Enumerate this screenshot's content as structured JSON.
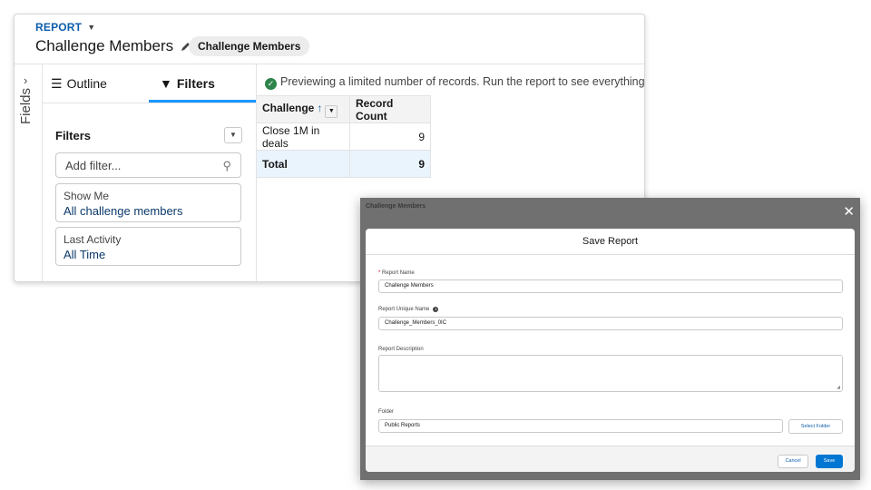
{
  "report": {
    "eyebrow": "REPORT",
    "title": "Challenge Members",
    "pill": "Challenge Members"
  },
  "rail": {
    "label": "Fields"
  },
  "tabs": [
    {
      "label": "Outline",
      "icon": "list-icon"
    },
    {
      "label": "Filters",
      "icon": "funnel-icon"
    }
  ],
  "filters": {
    "title": "Filters",
    "add_placeholder": "Add filter...",
    "items": [
      {
        "label": "Show Me",
        "value": "All challenge members"
      },
      {
        "label": "Last Activity",
        "value": "All Time"
      }
    ]
  },
  "preview": {
    "notice": "Previewing a limited number of records. Run the report to see everything.",
    "columns": [
      "Challenge",
      "Record Count"
    ],
    "rows": [
      {
        "challenge": "Close 1M in deals",
        "count": "9"
      }
    ],
    "total": {
      "label": "Total",
      "count": "9"
    }
  },
  "modal": {
    "bg_title": "Challenge Members",
    "title": "Save Report",
    "report_name_label": "Report Name",
    "report_name_value": "Challenge Members",
    "unique_name_label": "Report Unique Name",
    "unique_name_value": "Challenge_Members_0IC",
    "description_label": "Report Description",
    "folder_label": "Folder",
    "folder_value": "Public Reports",
    "select_folder": "Select Folder",
    "cancel": "Cancel",
    "save": "Save"
  },
  "colors": {
    "brand_blue": "#0176d3",
    "link_blue": "#0b5cab",
    "success_green": "#2e844a",
    "tab_accent": "#1b96ff"
  }
}
